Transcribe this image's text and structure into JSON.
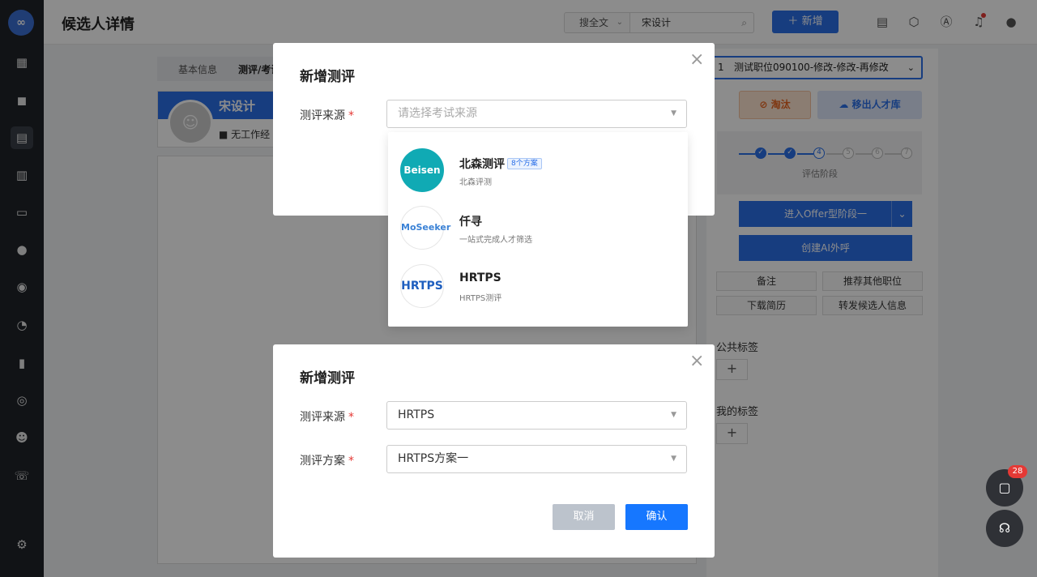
{
  "topbar": {
    "title": "候选人详情",
    "search_type": "搜全文",
    "search_value": "宋设计",
    "add_label": "新增"
  },
  "tabs": [
    "基本信息",
    "测评/考试"
  ],
  "candidate": {
    "name": "宋设计",
    "experience": "无工作经"
  },
  "right": {
    "position_prefix": "1",
    "position": "测试职位090100-修改-修改-再修改",
    "eliminate": "淘汰",
    "remove_talent": "移出人才库",
    "steps": [
      "4",
      "5",
      "6",
      "7"
    ],
    "stage_label": "评估阶段",
    "offer_stage": "进入Offer型阶段一",
    "ai_call": "创建AI外呼",
    "actions": [
      "备注",
      "推荐其他职位",
      "下载简历",
      "转发候选人信息"
    ],
    "public_tags": "公共标签",
    "my_tags": "我的标签",
    "plus": "+"
  },
  "float": {
    "badge": "28"
  },
  "dialog1": {
    "title": "新增测评",
    "source_label": "测评来源",
    "required": "*",
    "source_placeholder": "请选择考试来源",
    "options": [
      {
        "name": "北森测评",
        "tag": "8个方案",
        "desc": "北森评测",
        "logo": "Beisen"
      },
      {
        "name": "仟寻",
        "tag": "",
        "desc": "一站式完成人才筛选",
        "logo": "MoSeeker"
      },
      {
        "name": "HRTPS",
        "tag": "",
        "desc": "HRTPS测评",
        "logo": "HRTPS"
      }
    ]
  },
  "dialog2": {
    "title": "新增测评",
    "source_label": "测评来源",
    "source_value": "HRTPS",
    "plan_label": "测评方案",
    "plan_value": "HRTPS方案一",
    "required": "*",
    "cancel": "取消",
    "confirm": "确认"
  }
}
